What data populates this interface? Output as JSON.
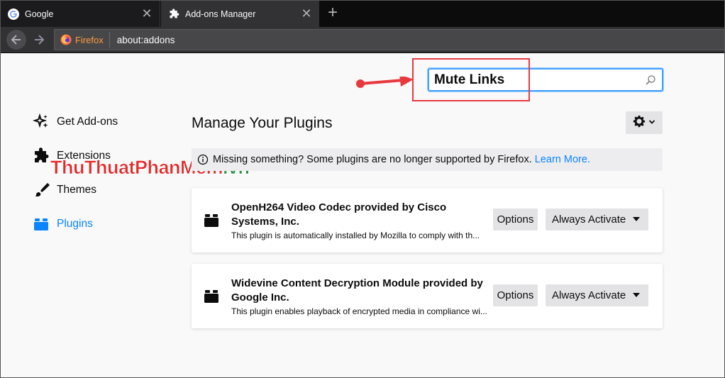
{
  "tabs": [
    {
      "label": "Google",
      "icon": "google-icon"
    },
    {
      "label": "Add-ons Manager",
      "icon": "puzzle-icon"
    }
  ],
  "navbar": {
    "identity_label": "Firefox",
    "url": "about:addons"
  },
  "search": {
    "value": "Mute Links",
    "placeholder": ""
  },
  "annotation": {
    "color": "#e8393f"
  },
  "sidebar": {
    "items": [
      {
        "label": "Get Add-ons",
        "icon": "sparkle-icon",
        "active": false
      },
      {
        "label": "Extensions",
        "icon": "puzzle-icon",
        "active": false
      },
      {
        "label": "Themes",
        "icon": "brush-icon",
        "active": false
      },
      {
        "label": "Plugins",
        "icon": "plugin-block-icon",
        "active": true
      }
    ]
  },
  "watermark": {
    "part1": "ThuThuat",
    "part2": "PhanMem",
    "part3": ".vn"
  },
  "main": {
    "title": "Manage Your Plugins",
    "notice": {
      "text": "Missing something? Some plugins are no longer supported by Firefox.",
      "link": "Learn More."
    },
    "plugins": [
      {
        "name": "OpenH264 Video Codec provided by Cisco Systems, Inc.",
        "description": "This plugin is automatically installed by Mozilla to comply with th...",
        "options_label": "Options",
        "activation": "Always Activate"
      },
      {
        "name": "Widevine Content Decryption Module provided by Google Inc.",
        "description": "This plugin enables playback of encrypted media in compliance wi...",
        "options_label": "Options",
        "activation": "Always Activate"
      }
    ]
  },
  "colors": {
    "accent": "#0a84ff",
    "tab_bg_dark": "#0c0c0d",
    "toolbar_bg": "#323234",
    "search_focus": "#45a1ff"
  }
}
